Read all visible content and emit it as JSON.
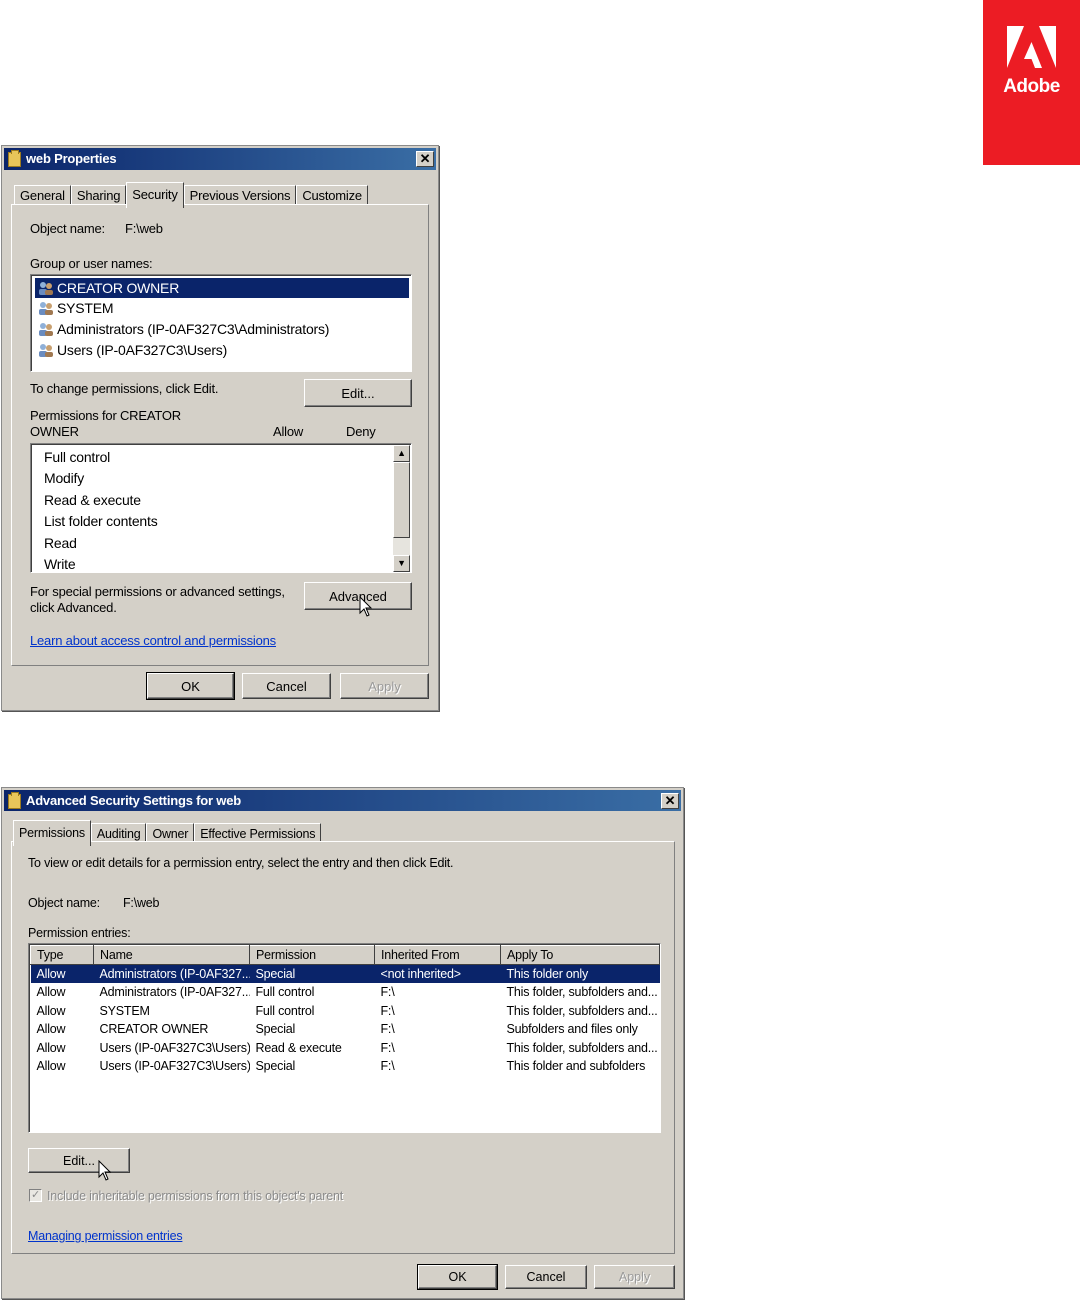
{
  "brand": {
    "logo_text": "Adobe",
    "color": "#ec1c24"
  },
  "dialog1": {
    "title": "web Properties",
    "close_glyph": "✕",
    "tabs": [
      "General",
      "Sharing",
      "Security",
      "Previous Versions",
      "Customize"
    ],
    "active_tab": "Security",
    "object_name_label": "Object name:",
    "object_name_value": "F:\\web",
    "group_label": "Group or user names:",
    "users": [
      "CREATOR OWNER",
      "SYSTEM",
      "Administrators (IP-0AF327C3\\Administrators)",
      "Users (IP-0AF327C3\\Users)"
    ],
    "selected_user": "CREATOR OWNER",
    "change_hint": "To change permissions, click Edit.",
    "edit_button": "Edit...",
    "perms_for_line1": "Permissions for CREATOR",
    "perms_for_line2": "OWNER",
    "allow_header": "Allow",
    "deny_header": "Deny",
    "permissions": [
      "Full control",
      "Modify",
      "Read & execute",
      "List folder contents",
      "Read",
      "Write"
    ],
    "special_hint_line1": "For special permissions or advanced settings,",
    "special_hint_line2": "click Advanced.",
    "advanced_button": "Advanced",
    "learn_link": "Learn about access control and permissions",
    "ok_button": "OK",
    "cancel_button": "Cancel",
    "apply_button": "Apply"
  },
  "dialog2": {
    "title": "Advanced Security Settings for web",
    "close_glyph": "✕",
    "tabs": [
      "Permissions",
      "Auditing",
      "Owner",
      "Effective Permissions"
    ],
    "active_tab": "Permissions",
    "intro": "To view or edit details for a permission entry, select the entry and then click Edit.",
    "object_name_label": "Object name:",
    "object_name_value": "F:\\web",
    "entries_label": "Permission entries:",
    "columns": [
      "Type",
      "Name",
      "Permission",
      "Inherited From",
      "Apply To"
    ],
    "rows": [
      [
        "Allow",
        "Administrators (IP-0AF327...",
        "Special",
        "<not inherited>",
        "This folder only"
      ],
      [
        "Allow",
        "Administrators (IP-0AF327...",
        "Full control",
        "F:\\",
        "This folder, subfolders and..."
      ],
      [
        "Allow",
        "SYSTEM",
        "Full control",
        "F:\\",
        "This folder, subfolders and..."
      ],
      [
        "Allow",
        "CREATOR OWNER",
        "Special",
        "F:\\",
        "Subfolders and files only"
      ],
      [
        "Allow",
        "Users (IP-0AF327C3\\Users)",
        "Read & execute",
        "F:\\",
        "This folder, subfolders and..."
      ],
      [
        "Allow",
        "Users (IP-0AF327C3\\Users)",
        "Special",
        "F:\\",
        "This folder and subfolders"
      ]
    ],
    "selected_row": 0,
    "edit_button": "Edit...",
    "include_inheritable": "Include inheritable permissions from this object's parent",
    "include_checked": true,
    "manage_link": "Managing permission entries",
    "ok_button": "OK",
    "cancel_button": "Cancel",
    "apply_button": "Apply"
  }
}
